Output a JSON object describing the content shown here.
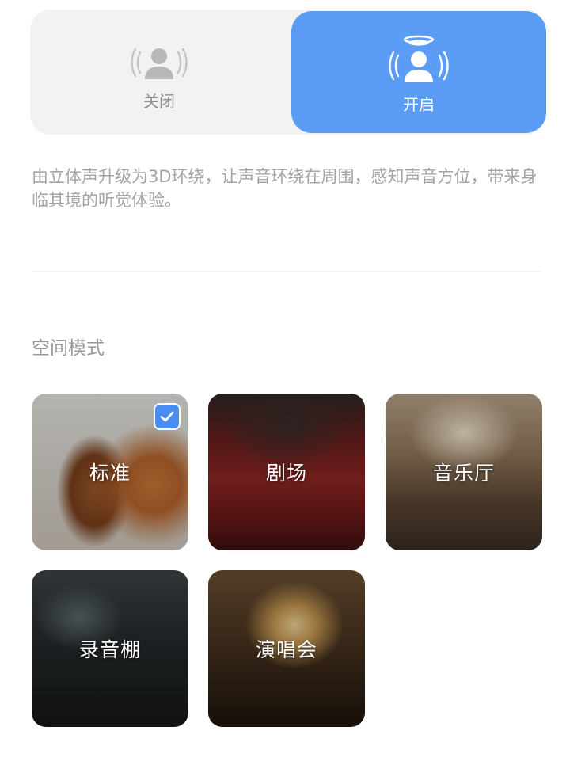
{
  "toggle": {
    "off_label": "关闭",
    "on_label": "开启",
    "selected": "on",
    "accent_color": "#5b9cf5"
  },
  "description": "由立体声升级为3D环绕，让声音环绕在周围，感知声音方位，带来身临其境的听觉体验。",
  "section": {
    "title": "空间模式"
  },
  "modes": [
    {
      "label": "标准",
      "selected": true
    },
    {
      "label": "剧场",
      "selected": false
    },
    {
      "label": "音乐厅",
      "selected": false
    },
    {
      "label": "录音棚",
      "selected": false
    },
    {
      "label": "演唱会",
      "selected": false
    }
  ],
  "icons": {
    "off_icon": "person-sound-icon",
    "on_icon": "person-surround-sound-icon",
    "check_icon": "checkmark-icon"
  }
}
